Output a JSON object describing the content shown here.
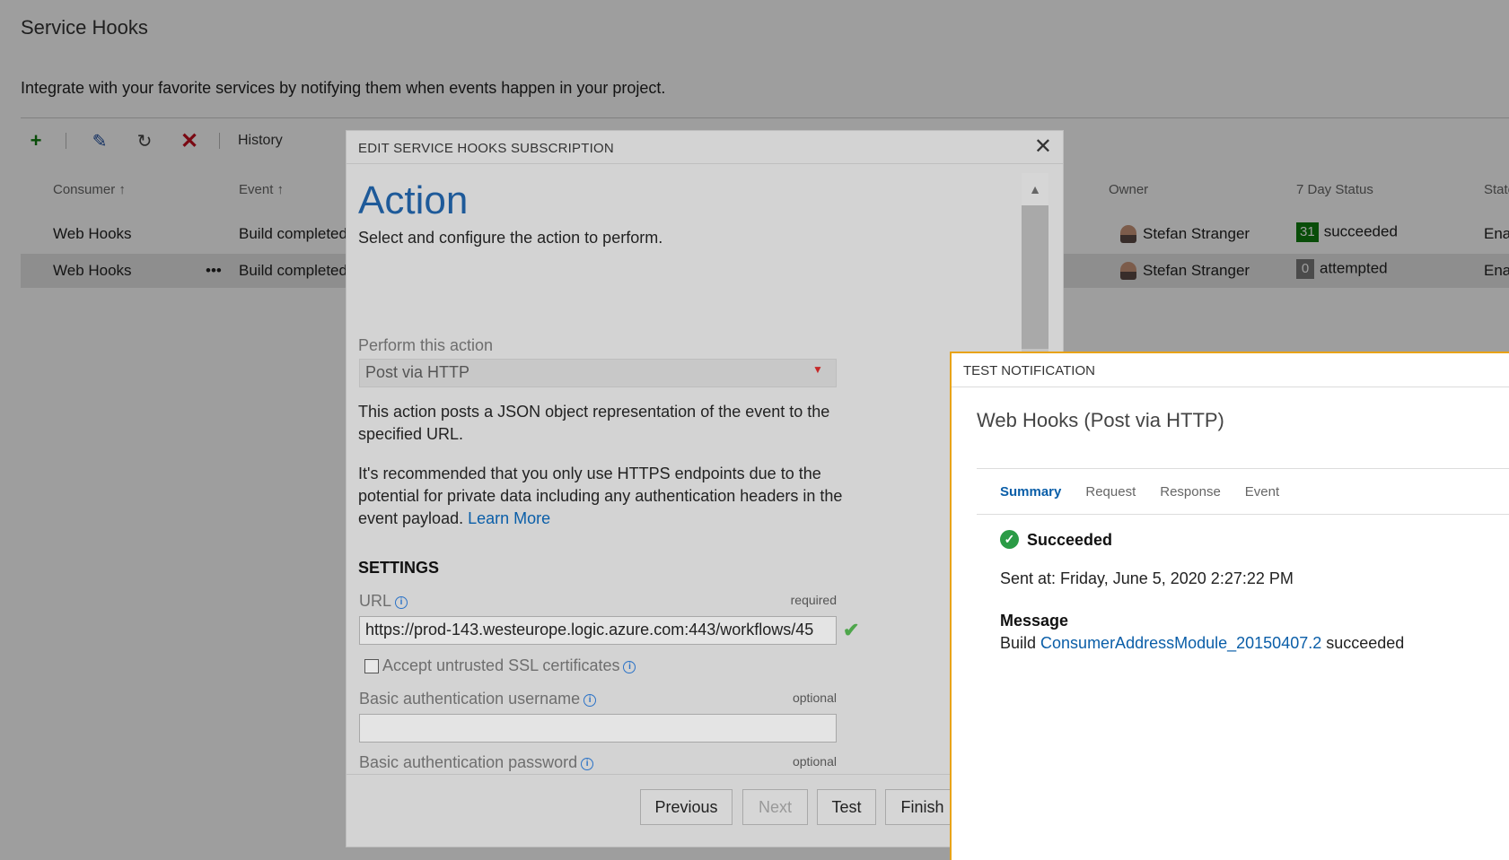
{
  "page": {
    "title": "Service Hooks",
    "description": "Integrate with your favorite services by notifying them when events happen in your project.",
    "toolbar": {
      "history_label": "History"
    },
    "columns": {
      "consumer": "Consumer",
      "event": "Event",
      "owner": "Owner",
      "status": "7 Day Status",
      "state": "State"
    },
    "rows": [
      {
        "consumer": "Web Hooks",
        "event": "Build completed",
        "owner": "Stefan Stranger",
        "status_count": "31",
        "status_text": "succeeded",
        "state": "Enabled"
      },
      {
        "consumer": "Web Hooks",
        "event": "Build completed",
        "owner": "Stefan Stranger",
        "status_count": "0",
        "status_text": "attempted",
        "state": "Enabled",
        "more": "•••"
      }
    ]
  },
  "dialog": {
    "title": "EDIT SERVICE HOOKS SUBSCRIPTION",
    "heading": "Action",
    "subheading": "Select and configure the action to perform.",
    "perform_label": "Perform this action",
    "perform_value": "Post via HTTP",
    "desc1": "This action posts a JSON object representation of the event to the specified URL.",
    "desc2": "It's recommended that you only use HTTPS endpoints due to the potential for private data including any authentication headers in the event payload.",
    "learn_more": "Learn More",
    "settings": "SETTINGS",
    "url_label": "URL",
    "url_req": "required",
    "url_value": "https://prod-143.westeurope.logic.azure.com:443/workflows/45",
    "ssl_label": "Accept untrusted SSL certificates",
    "user_label": "Basic authentication username",
    "user_opt": "optional",
    "pass_label": "Basic authentication password",
    "pass_opt": "optional",
    "buttons": {
      "previous": "Previous",
      "next": "Next",
      "test": "Test",
      "finish": "Finish"
    }
  },
  "notification": {
    "title": "TEST NOTIFICATION",
    "subtitle": "Web Hooks (Post via HTTP)",
    "tabs": [
      "Summary",
      "Request",
      "Response",
      "Event"
    ],
    "status": "Succeeded",
    "sent": "Sent at: Friday, June 5, 2020 2:27:22 PM",
    "message_label": "Message",
    "message_prefix": "Build ",
    "message_link": "ConsumerAddressModule_20150407.2",
    "message_suffix": " succeeded"
  },
  "colors": {
    "accent": "#1e5a99",
    "success": "#107c10",
    "error": "#c50f1f",
    "panel_border": "#e8a317"
  },
  "icons": [
    "add-icon",
    "edit-icon",
    "refresh-icon",
    "delete-icon",
    "sort-arrow-icon",
    "close-icon",
    "info-icon",
    "checkmark-icon",
    "success-icon"
  ]
}
